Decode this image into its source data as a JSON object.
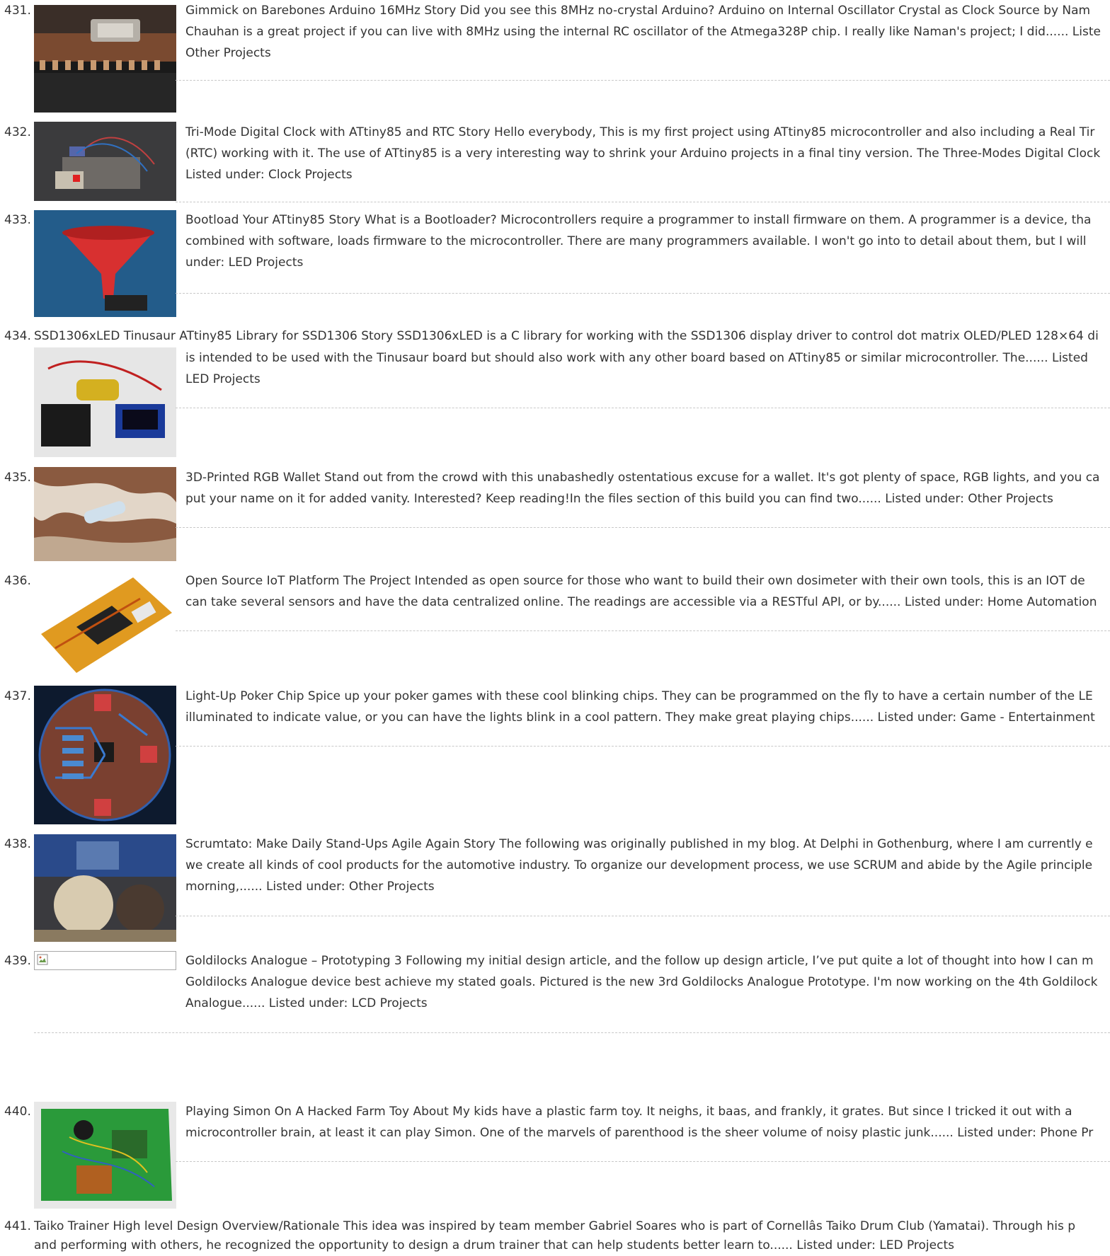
{
  "entries": [
    {
      "num": "431.",
      "lines": [
        "Gimmick on Barebones Arduino 16MHz Story Did you see this 8MHz no-crystal Arduino? Arduino on Internal Oscillator Crystal as Clock Source by Nam",
        "Chauhan is a great project if you can live with 8MHz using the internal RC oscillator of the Atmega328P chip. I really like Naman's project; I did...... Liste",
        "Other Projects"
      ],
      "image": "arduino-board-photo"
    },
    {
      "num": "432.",
      "lines": [
        "Tri-Mode Digital Clock with ATtiny85 and RTC Story Hello everybody, This is my first project using ATtiny85 microcontroller and also including a Real Tir",
        "(RTC) working with it. The use of ATtiny85 is a very interesting way to shrink your Arduino projects in a final tiny version. The Three-Modes Digital Clock",
        "Listed under: Clock Projects"
      ],
      "image": "breadboard-clock-photo"
    },
    {
      "num": "433.",
      "lines": [
        "Bootload Your ATtiny85 Story What is a Bootloader? Microcontrollers require a programmer to install firmware on them. A programmer is a device, tha",
        "combined with software, loads firmware to the microcontroller. There are many programmers available. I won't go into to detail about them, but I will",
        "under: LED Projects"
      ],
      "image": "red-funnel-photo"
    },
    {
      "num": "434.",
      "title_line": "SSD1306xLED Tinusaur ATtiny85 Library for SSD1306 Story SSD1306xLED is a C library for working with the SSD1306 display driver to control dot matrix OLED/PLED 128×64 di",
      "lines": [
        "is intended to be used with the Tinusaur board but should also work with any other board based on ATtiny85 or similar microcontroller. The...... Listed",
        "LED Projects"
      ],
      "image": "oled-board-photo"
    },
    {
      "num": "435.",
      "lines": [
        "3D-Printed RGB Wallet Stand out from the crowd with this unabashedly ostentatious excuse for a wallet. It's got plenty of space, RGB lights, and you ca",
        "put your name on it for added vanity. Interested? Keep reading!In the files section of this build you can find two...... Listed under: Other Projects"
      ],
      "image": "wallet-on-granite-photo"
    },
    {
      "num": "436.",
      "lines": [
        "Open Source IoT Platform The Project Intended as open source for those who want to build their own dosimeter with their own tools, this is an IOT de",
        "can take several sensors and have the data centralized online. The readings are accessible via a RESTful API, or by...... Listed under: Home Automation"
      ],
      "image": "iot-pcb-photo"
    },
    {
      "num": "437.",
      "lines": [
        "Light-Up Poker Chip Spice up your poker games with these cool blinking chips. They can be programmed on the fly to have a certain number of the LE",
        "illuminated to indicate value, or you can have the lights blink in a cool pattern. They make great playing chips...... Listed under: Game - Entertainment"
      ],
      "image": "round-pcb-layout"
    },
    {
      "num": "438.",
      "lines": [
        "Scrumtato: Make Daily Stand-Ups Agile Again Story The following was originally published in my blog. At Delphi in Gothenburg, where I am currently e",
        "we create all kinds of cool products for the automotive industry. To organize our development process, we use SCRUM and abide by the Agile principle",
        "morning,...... Listed under: Other Projects"
      ],
      "image": "potato-devices-photo"
    },
    {
      "num": "439.",
      "lines": [
        "Goldilocks Analogue – Prototyping 3 Following my initial design article, and the follow up design article, I’ve put quite a lot of thought into how I can m",
        "Goldilocks Analogue device best achieve my stated goals. Pictured is the new 3rd Goldilocks Analogue Prototype. I'm now working on the 4th Goldilock",
        "Analogue...... Listed under: LCD Projects"
      ],
      "image": "broken-image"
    },
    {
      "num": "440.",
      "lines": [
        "Playing Simon On A Hacked Farm Toy About My kids have a plastic farm toy. It neighs, it baas, and frankly, it grates. But since I tricked it out with a",
        "microcontroller brain, at least it can play Simon. One of the marvels of parenthood is the sheer volume of noisy plastic junk...... Listed under: Phone Pr"
      ],
      "image": "green-toy-pcb-photo"
    },
    {
      "num": "441.",
      "title_line": "Taiko Trainer High level Design Overview/Rationale This idea was inspired by team member Gabriel Soares who is part of Cornellâs Taiko Drum Club (Yamatai). Through his p",
      "lines": [
        "and performing with others, he recognized the opportunity to design a drum trainer that can help students better learn to...... Listed under: LED Projects"
      ],
      "image": ""
    }
  ],
  "colors": {
    "text": "#333333",
    "separator": "#c8c8c8",
    "background": "#ffffff"
  }
}
